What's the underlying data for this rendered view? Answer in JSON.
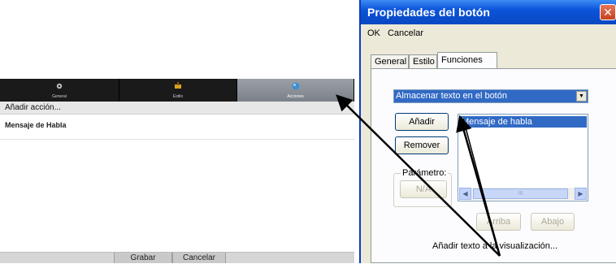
{
  "mobile": {
    "tabs": [
      {
        "label": "General"
      },
      {
        "label": "Estilo"
      },
      {
        "label": "Acciones"
      }
    ],
    "add_action": "Añadir acción...",
    "item": "Mensaje de Habla",
    "save_button": "Grabar",
    "cancel_button": "Cancelar"
  },
  "dialog": {
    "title": "Propiedades del botón",
    "close_glyph": "✕",
    "menu": {
      "ok": "OK",
      "cancel": "Cancelar"
    },
    "tabs": [
      "General",
      "Estilo",
      "Funciones"
    ],
    "function_select": "Almacenar texto en el botón",
    "add_button": "Añadir",
    "remove_button": "Remover",
    "list_items": [
      "Mensaje de habla"
    ],
    "param_group": "Parámetro:",
    "param_button": "N/A",
    "up_button": "Arriba",
    "down_button": "Abajo",
    "status_text": "Añadir texto a la visualización...",
    "scroll_grip": "III"
  },
  "colors": {
    "title_blue": "#0a54d9",
    "selection": "#316ac5",
    "close_red": "#d9532f"
  }
}
